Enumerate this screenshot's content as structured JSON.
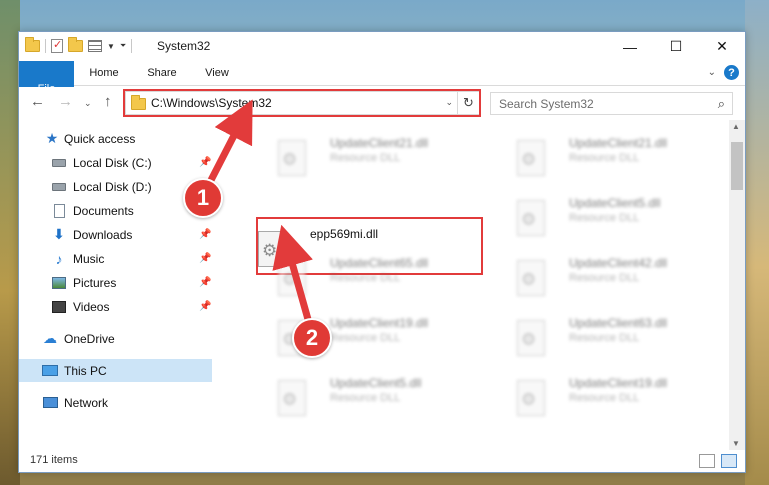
{
  "window": {
    "title": "System32",
    "controls": {
      "minimize": "—",
      "maximize": "☐",
      "close": "✕"
    }
  },
  "ribbon": {
    "tabs": [
      {
        "label": "File"
      },
      {
        "label": "Home"
      },
      {
        "label": "Share"
      },
      {
        "label": "View"
      }
    ],
    "help": "?"
  },
  "address": {
    "path": "C:\\Windows\\System32",
    "refresh": "↻"
  },
  "search": {
    "placeholder": "Search System32",
    "icon": "⌕"
  },
  "nav": {
    "items": [
      {
        "label": "Quick access",
        "icon": "star-icon",
        "pinned": false
      },
      {
        "label": "Local Disk (C:)",
        "icon": "disk-icon",
        "pinned": true
      },
      {
        "label": "Local Disk (D:)",
        "icon": "disk-icon",
        "pinned": false
      },
      {
        "label": "Documents",
        "icon": "document-icon",
        "pinned": false
      },
      {
        "label": "Downloads",
        "icon": "download-icon",
        "pinned": true
      },
      {
        "label": "Music",
        "icon": "music-icon",
        "pinned": true
      },
      {
        "label": "Pictures",
        "icon": "pictures-icon",
        "pinned": true
      },
      {
        "label": "Videos",
        "icon": "videos-icon",
        "pinned": true
      },
      {
        "label": "OneDrive",
        "icon": "cloud-icon",
        "pinned": false
      },
      {
        "label": "This PC",
        "icon": "computer-icon",
        "pinned": false,
        "selected": true
      },
      {
        "label": "Network",
        "icon": "network-icon",
        "pinned": false
      }
    ]
  },
  "files": [
    {
      "name": "UpdateClient21.dll",
      "type": "Resource DLL"
    },
    {
      "name": "UpdateClient21.dll",
      "type": "Resource DLL"
    },
    {
      "name": "epp569mi.dll",
      "type": ""
    },
    {
      "name": "UpdateClient5.dll",
      "type": "Resource DLL"
    },
    {
      "name": "UpdateClient65.dll",
      "type": "Resource DLL"
    },
    {
      "name": "UpdateClient42.dll",
      "type": "Resource DLL"
    },
    {
      "name": "UpdateClient19.dll",
      "type": "Resource DLL"
    },
    {
      "name": "UpdateClient63.dll",
      "type": "Resource DLL"
    },
    {
      "name": "UpdateClient5.dll",
      "type": "Resource DLL"
    },
    {
      "name": "UpdateClient19.dll",
      "type": "Resource DLL"
    }
  ],
  "status": {
    "item_count": "171 items"
  },
  "annotations": {
    "step1": "1",
    "step2": "2",
    "color": "#e23b3b"
  }
}
